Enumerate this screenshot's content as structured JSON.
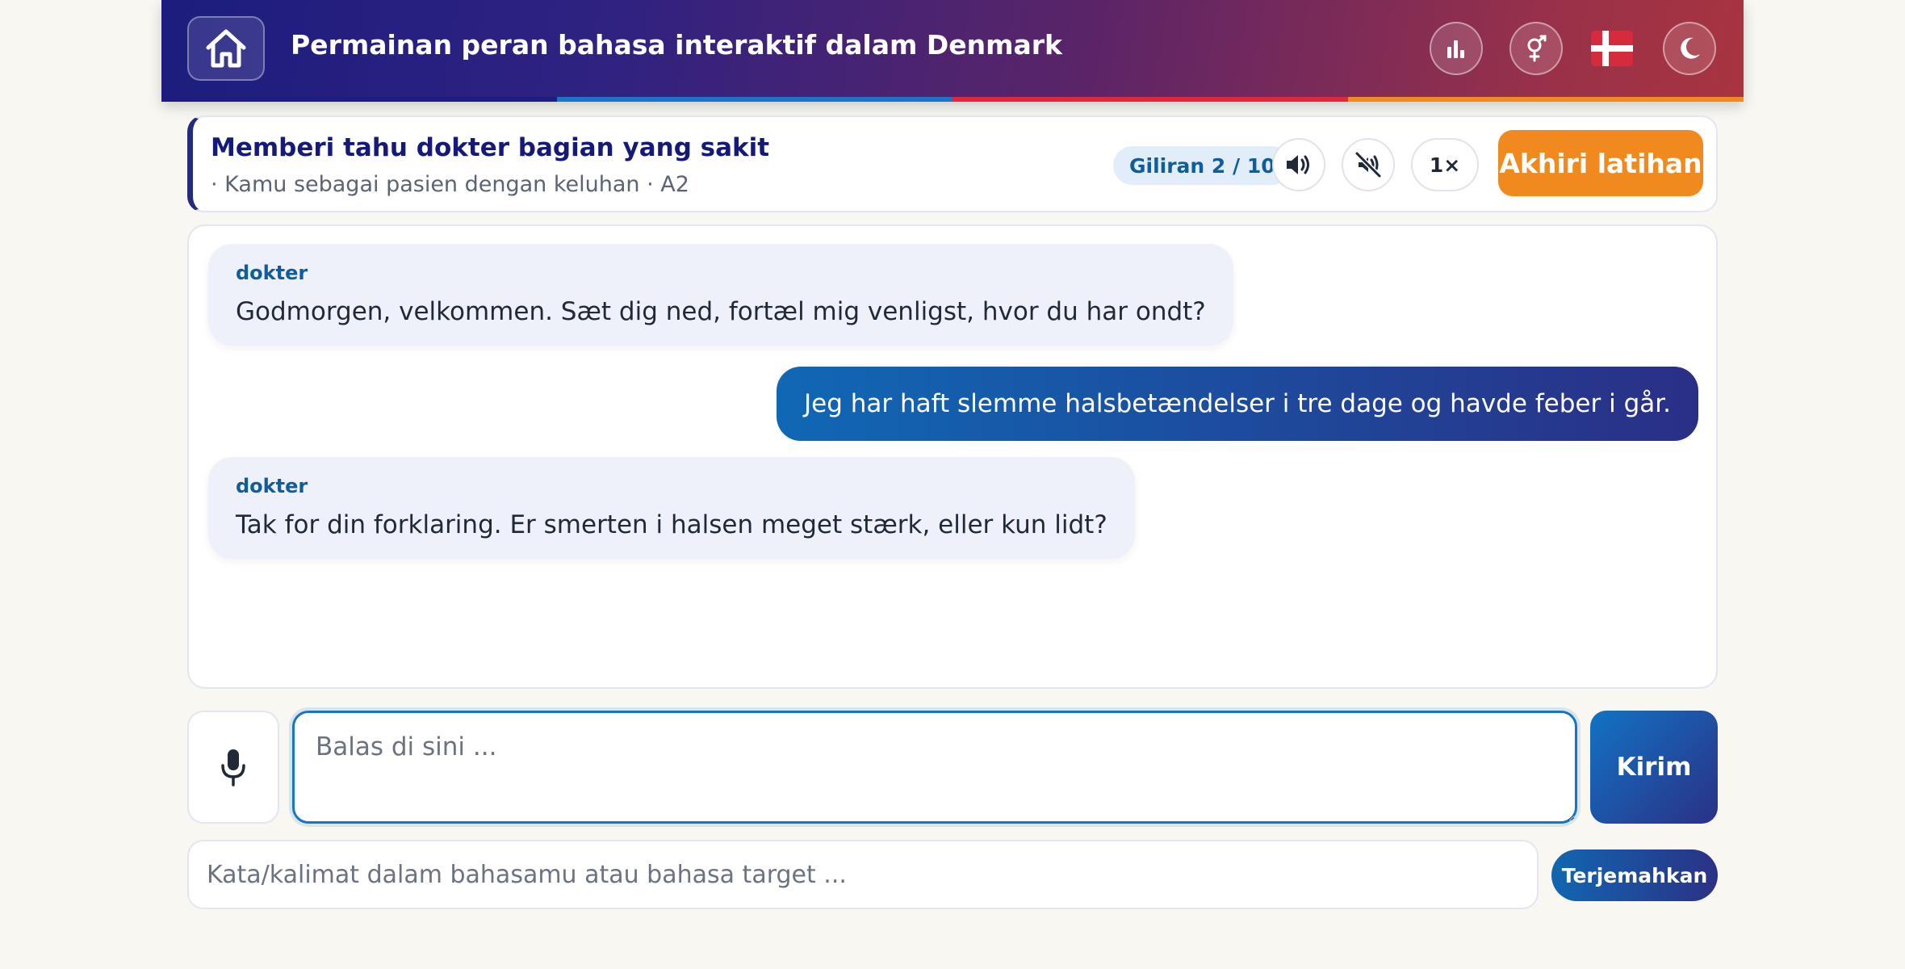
{
  "header": {
    "title": "Permainan peran bahasa interaktif dalam Denmark",
    "home_icon": "home-icon",
    "stats_icon": "bar-chart-icon",
    "gender_icon": "gender-icon",
    "flag": "denmark-flag",
    "theme_icon": "moon-icon",
    "stripe_colors": [
      "#1c1d7e",
      "#1b74c8",
      "#e0273d",
      "#f08a1f"
    ]
  },
  "task": {
    "title": "Memberi tahu dokter bagian yang sakit",
    "subtitle": "· Kamu sebagai pasien dengan keluhan · A2",
    "turn_label": "Giliran 2 / 10",
    "speed_label": "1×",
    "end_button": "Akhiri latihan",
    "speaker_icon": "speaker-icon",
    "mute_icon": "mute-icon"
  },
  "messages": [
    {
      "role": "ai",
      "speaker": "dokter",
      "text": "Godmorgen, velkommen. Sæt dig ned, fortæl mig venligst, hvor du har ondt?"
    },
    {
      "role": "user",
      "text": "Jeg har haft slemme halsbetændelser i tre dage og havde feber i går."
    },
    {
      "role": "ai",
      "speaker": "dokter",
      "text": "Tak for din forklaring. Er smerten i halsen meget stærk, eller kun lidt?"
    }
  ],
  "composer": {
    "placeholder": "Balas di sini ...",
    "send_label": "Kirim",
    "mic_icon": "microphone-icon"
  },
  "translator": {
    "placeholder": "Kata/kalimat dalam bahasamu atau bahasa target ...",
    "button_label": "Terjemahkan"
  },
  "colors": {
    "accent_blue": "#1775c4",
    "accent_orange": "#f08a1f",
    "navy": "#14197a"
  }
}
